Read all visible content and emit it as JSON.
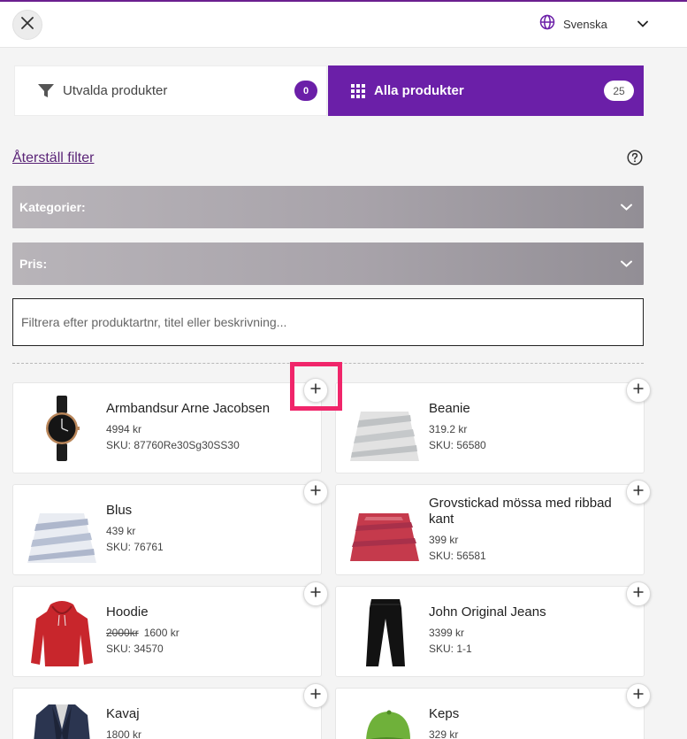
{
  "header": {
    "close_icon": "close-icon",
    "language": {
      "label": "Svenska",
      "icon": "globe-icon"
    }
  },
  "tabs": {
    "selected": {
      "label": "Utvalda produkter",
      "count": "0",
      "icon": "filter-icon"
    },
    "all": {
      "label": "Alla produkter",
      "count": "25",
      "icon": "grid-icon"
    }
  },
  "filters": {
    "reset_label": "Återställ filter",
    "categories_label": "Kategorier:",
    "price_label": "Pris:",
    "search_placeholder": "Filtrera efter produktartnr, titel eller beskrivning..."
  },
  "products": [
    {
      "title": "Armbandsur Arne Jacobsen",
      "price": "4994 kr",
      "sku": "SKU: 87760Re30Sg30SS30",
      "image": "watch"
    },
    {
      "title": "Beanie",
      "price": "319.2 kr",
      "sku": "SKU: 56580",
      "image": "striped-rug"
    },
    {
      "title": "Blus",
      "price": "439 kr",
      "sku": "SKU: 76761",
      "image": "blue-rug"
    },
    {
      "title": "Grovstickad mössa med ribbad kant",
      "price": "399 kr",
      "sku": "SKU: 56581",
      "image": "red-rug"
    },
    {
      "title": "Hoodie",
      "old_price": "2000kr",
      "price": "1600 kr",
      "sku": "SKU: 34570",
      "image": "red-hoodie"
    },
    {
      "title": "John Original Jeans",
      "price": "3399 kr",
      "sku": "SKU: 1-1",
      "image": "black-jeans"
    },
    {
      "title": "Kavaj",
      "price": "1800 kr",
      "sku": "",
      "image": "blazer"
    },
    {
      "title": "Keps",
      "price": "329 kr",
      "sku": "",
      "image": "green-cap"
    }
  ],
  "colors": {
    "accent": "#6b1fa8",
    "link": "#5a2477",
    "highlight": "#f0256a"
  }
}
